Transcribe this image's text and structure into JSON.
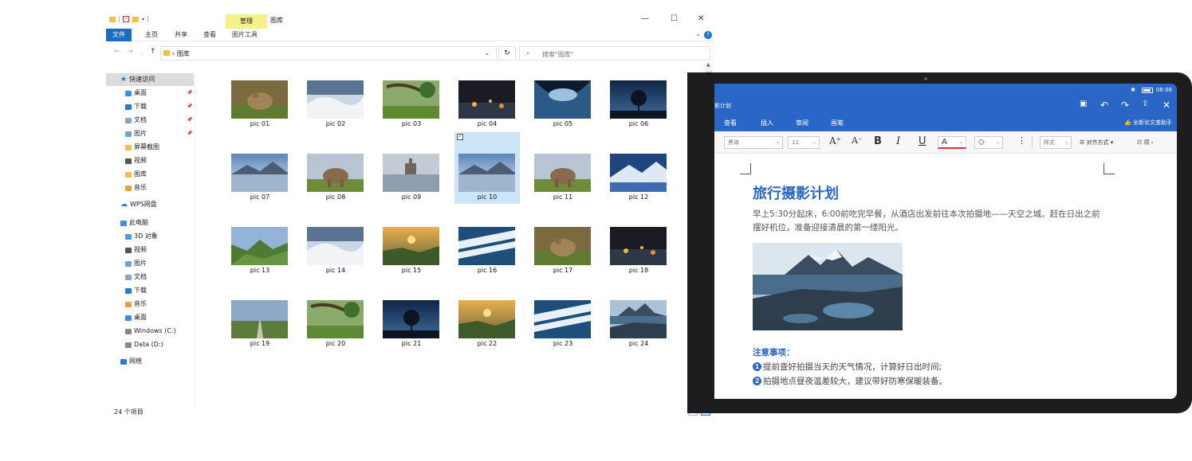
{
  "explorer": {
    "ribbon_context_label": "管理",
    "window_title": "图库",
    "ribbon_tabs": [
      "文件",
      "主页",
      "共享",
      "查看",
      "图片工具"
    ],
    "address": {
      "crumb": "图库",
      "search_placeholder": "搜索\"图库\""
    },
    "nav": {
      "quick_access": "快速访问",
      "quick_items": [
        "桌面",
        "下载",
        "文档",
        "图片",
        "屏幕截图",
        "视频",
        "图库",
        "音乐"
      ],
      "wps": "WPS网盘",
      "this_pc": "此电脑",
      "pc_items": [
        "3D 对象",
        "视频",
        "图片",
        "文档",
        "下载",
        "音乐",
        "桌面",
        "Windows (C:)",
        "Data (D:)"
      ],
      "network": "网络"
    },
    "files": [
      "pic 01",
      "pic 02",
      "pic 03",
      "pic 04",
      "pic 05",
      "pic 06",
      "pic 07",
      "pic 08",
      "pic 09",
      "pic 10",
      "pic 11",
      "pic 12",
      "pic 13",
      "pic 14",
      "pic 15",
      "pic 16",
      "pic 17",
      "pic 18",
      "pic 19",
      "pic 20",
      "pic 21",
      "pic 22",
      "pic 23",
      "pic 24"
    ],
    "selected_file": "pic 10",
    "status": "24 个项目"
  },
  "tablet": {
    "status_time": "08:08",
    "doc_title_tab": "影计划",
    "menu": [
      "查看",
      "插入",
      "审阅",
      "画笔"
    ],
    "assist_label": "全新论文查助手",
    "toolbar": {
      "font": "黑体",
      "size": "11",
      "style_label": "样式",
      "align_label": "对齐方式",
      "list_label": "项"
    },
    "document": {
      "title": "旅行摄影计划",
      "paragraph": "早上5:30分起床，6:00前吃完早餐，从酒店出发前往本次拍摄地——天空之城。赶在日出之前摆好机位，准备迎接清晨的第一缕阳光。",
      "notes_heading": "注意事项：",
      "notes": [
        {
          "num": "1",
          "text": "提前查好拍摄当天的天气情况，计算好日出时间;"
        },
        {
          "num": "2",
          "text": "拍摄地点昼夜温差较大，建议带好防寒保暖装备。"
        }
      ]
    }
  },
  "colors": {
    "wps_blue": "#2a66c6",
    "explorer_accent": "#1a6cc0",
    "selection": "#cce4f7",
    "context_tab": "#f6f08a"
  }
}
